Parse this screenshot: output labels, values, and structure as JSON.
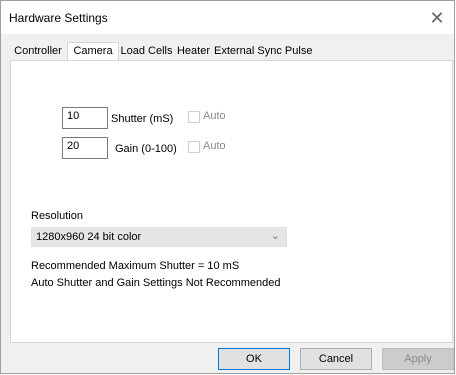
{
  "window": {
    "title": "Hardware Settings",
    "close_glyph": "✕"
  },
  "tabs": [
    {
      "label": "Controller",
      "active": false
    },
    {
      "label": "Camera",
      "active": true
    },
    {
      "label": "Load Cells",
      "active": false
    },
    {
      "label": "Heater",
      "active": false
    },
    {
      "label": "External Sync Pulse",
      "active": false
    }
  ],
  "camera": {
    "shutter": {
      "value": "10",
      "label": "Shutter (mS)",
      "auto_label": "Auto",
      "auto_checked": false
    },
    "gain": {
      "value": "20",
      "label": "Gain (0-100)",
      "auto_label": "Auto",
      "auto_checked": false
    },
    "resolution_label": "Resolution",
    "resolution_value": "1280x960 24 bit color",
    "recommended_text": "Recommended Maximum Shutter = 10 mS",
    "warning_text": "Auto Shutter and Gain Settings Not Recommended"
  },
  "buttons": {
    "ok": "OK",
    "cancel": "Cancel",
    "apply": "Apply"
  },
  "icons": {
    "dropdown": "chevron-down-icon",
    "close": "close-icon"
  }
}
